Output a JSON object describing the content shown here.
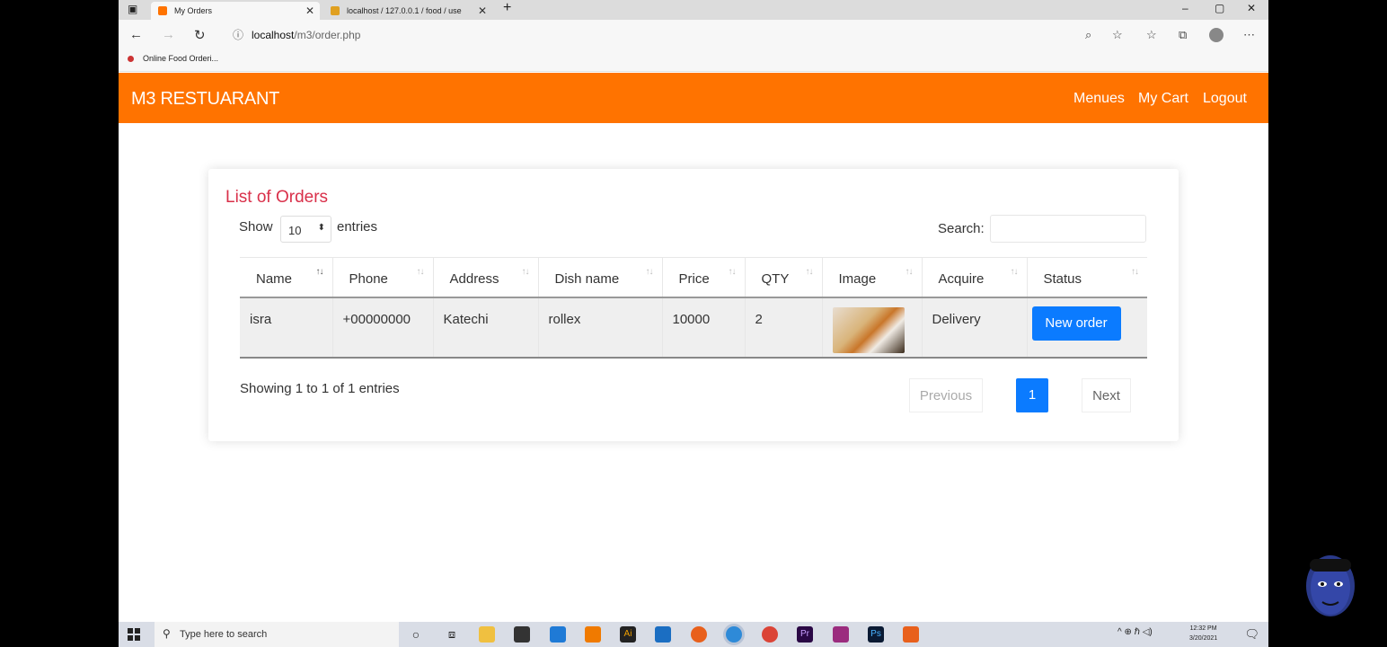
{
  "browser": {
    "tabs": [
      {
        "title": "My Orders",
        "active": true,
        "favicon_color": "#ff7300"
      },
      {
        "title": "localhost / 127.0.0.1 / food / use",
        "active": false,
        "favicon_color": "#e0a020"
      }
    ],
    "new_tab": "+",
    "window_controls": {
      "minimize": "–",
      "maximize": "▢",
      "close": "✕"
    },
    "url": {
      "host": "localhost",
      "path": "/m3/order.php"
    },
    "bookmark": "Online Food Orderi..."
  },
  "navbar": {
    "brand": "M3 RESTUARANT",
    "links": [
      "Menues",
      "My Cart",
      "Logout"
    ],
    "color": "#ff7300"
  },
  "orders": {
    "title": "List of Orders",
    "show_label": "Show",
    "entries_label": "entries",
    "page_length": "10",
    "search_label": "Search:",
    "search_value": "",
    "columns": [
      "Name",
      "Phone",
      "Address",
      "Dish name",
      "Price",
      "QTY",
      "Image",
      "Acquire",
      "Status"
    ],
    "rows": [
      {
        "name": "isra",
        "phone": "+00000000",
        "address": "Katechi",
        "dish": "rollex",
        "price": "10000",
        "qty": "2",
        "image": "food-thumbnail",
        "acquire": "Delivery",
        "status": "New order"
      }
    ],
    "info": "Showing 1 to 1 of 1 entries",
    "pagination": {
      "previous": "Previous",
      "current": "1",
      "next": "Next"
    }
  },
  "taskbar": {
    "search_placeholder": "Type here to search",
    "clock_time": "12:32 PM",
    "clock_date": "3/20/2021",
    "tray_text": "^ ⊕ ℏ ◁)"
  },
  "colors": {
    "accent": "#0b7bff",
    "title": "#d9304a"
  }
}
